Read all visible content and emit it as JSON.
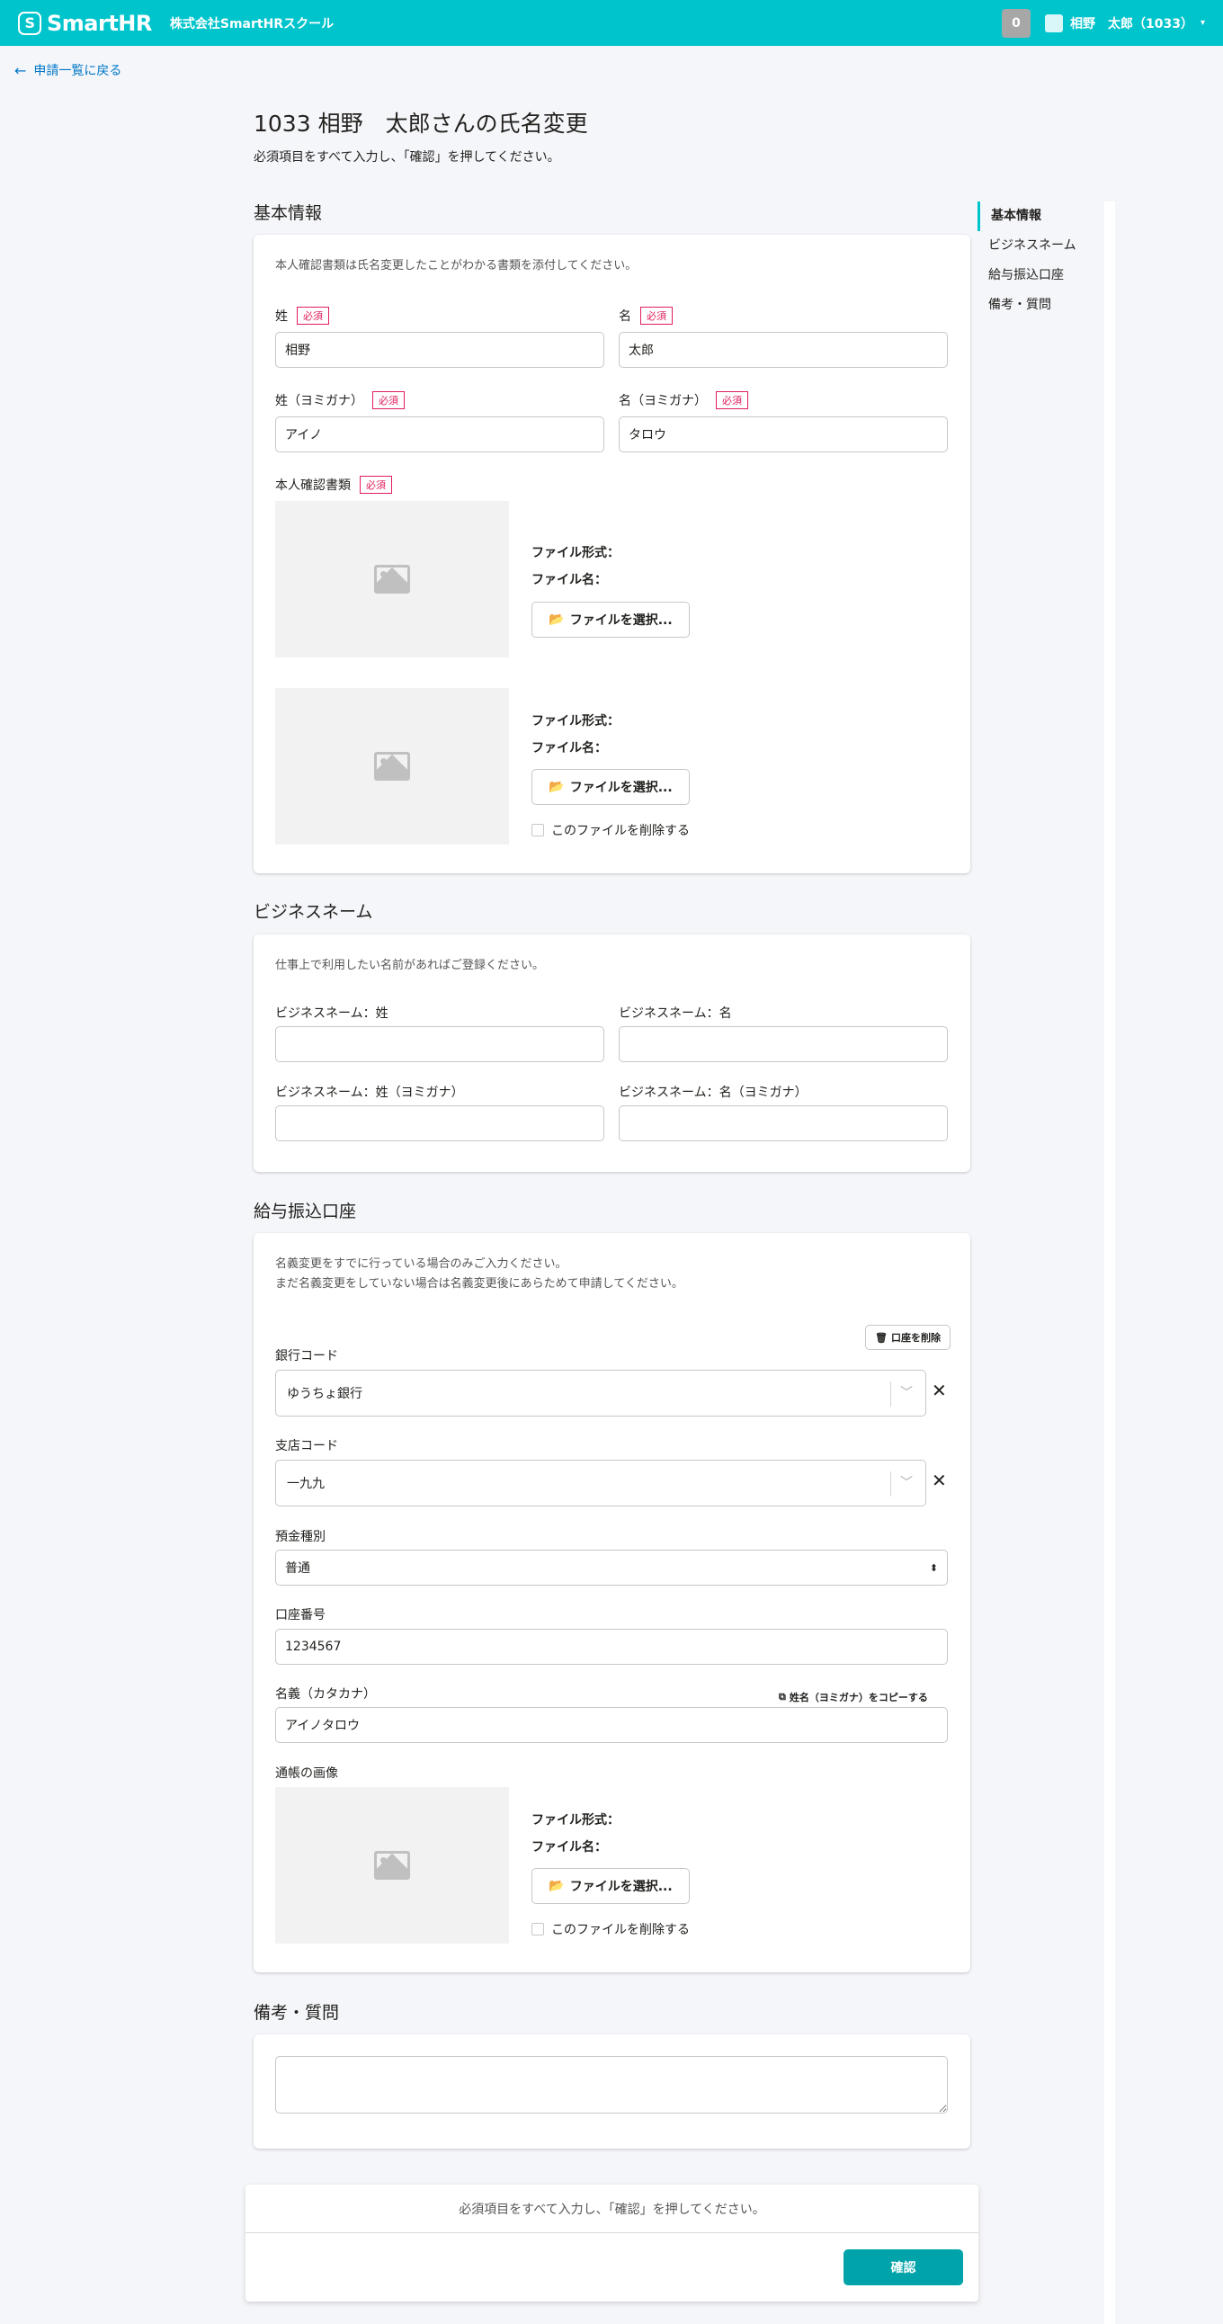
{
  "header": {
    "logo_text": "SmartHR",
    "company": "株式会社SmartHRスクール",
    "notification_count": "0",
    "user_name": "相野　太郎（1033）",
    "accent": "#00c4cc"
  },
  "back_link": "申請一覧に戻る",
  "page": {
    "title": "1033 相野　太郎さんの氏名変更",
    "subtitle": "必須項目をすべて入力し、「確認」を押してください。"
  },
  "sidenav": {
    "items": [
      "基本情報",
      "ビジネスネーム",
      "給与振込口座",
      "備考・質問"
    ]
  },
  "basic": {
    "heading": "基本情報",
    "note": "本人確認書類は氏名変更したことがわかる書類を添付してください。",
    "required_label": "必須",
    "last_name": {
      "label": "姓",
      "value": "相野"
    },
    "first_name": {
      "label": "名",
      "value": "太郎"
    },
    "last_kana": {
      "label": "姓（ヨミガナ）",
      "value": "アイノ"
    },
    "first_kana": {
      "label": "名（ヨミガナ）",
      "value": "タロウ"
    },
    "doc_label": "本人確認書類",
    "file_format": "ファイル形式：",
    "file_name": "ファイル名：",
    "select_file": "ファイルを選択...",
    "delete_file": "このファイルを削除する"
  },
  "business": {
    "heading": "ビジネスネーム",
    "note": "仕事上で利用したい名前があればご登録ください。",
    "last_label": "ビジネスネーム：姓",
    "first_label": "ビジネスネーム：名",
    "last_kana_label": "ビジネスネーム：姓（ヨミガナ）",
    "first_kana_label": "ビジネスネーム：名（ヨミガナ）"
  },
  "bank": {
    "heading": "給与振込口座",
    "note1": "名義変更をすでに行っている場合のみご入力ください。",
    "note2": "まだ名義変更をしていない場合は名義変更後にあらためて申請してください。",
    "delete_account": "口座を削除",
    "bank_code_label": "銀行コード",
    "bank_code_value": "ゆうちょ銀行",
    "branch_label": "支店コード",
    "branch_value": "一九九",
    "deposit_label": "預金種別",
    "deposit_value": "普通",
    "account_label": "口座番号",
    "account_value": "1234567",
    "holder_label": "名義（カタカナ）",
    "copy_kana": "姓名（ヨミガナ）をコピーする",
    "holder_value": "アイノタロウ",
    "passbook_label": "通帳の画像"
  },
  "remarks": {
    "heading": "備考・質問"
  },
  "footer": {
    "message": "必須項目をすべて入力し、「確認」を押してください。",
    "confirm": "確認"
  }
}
